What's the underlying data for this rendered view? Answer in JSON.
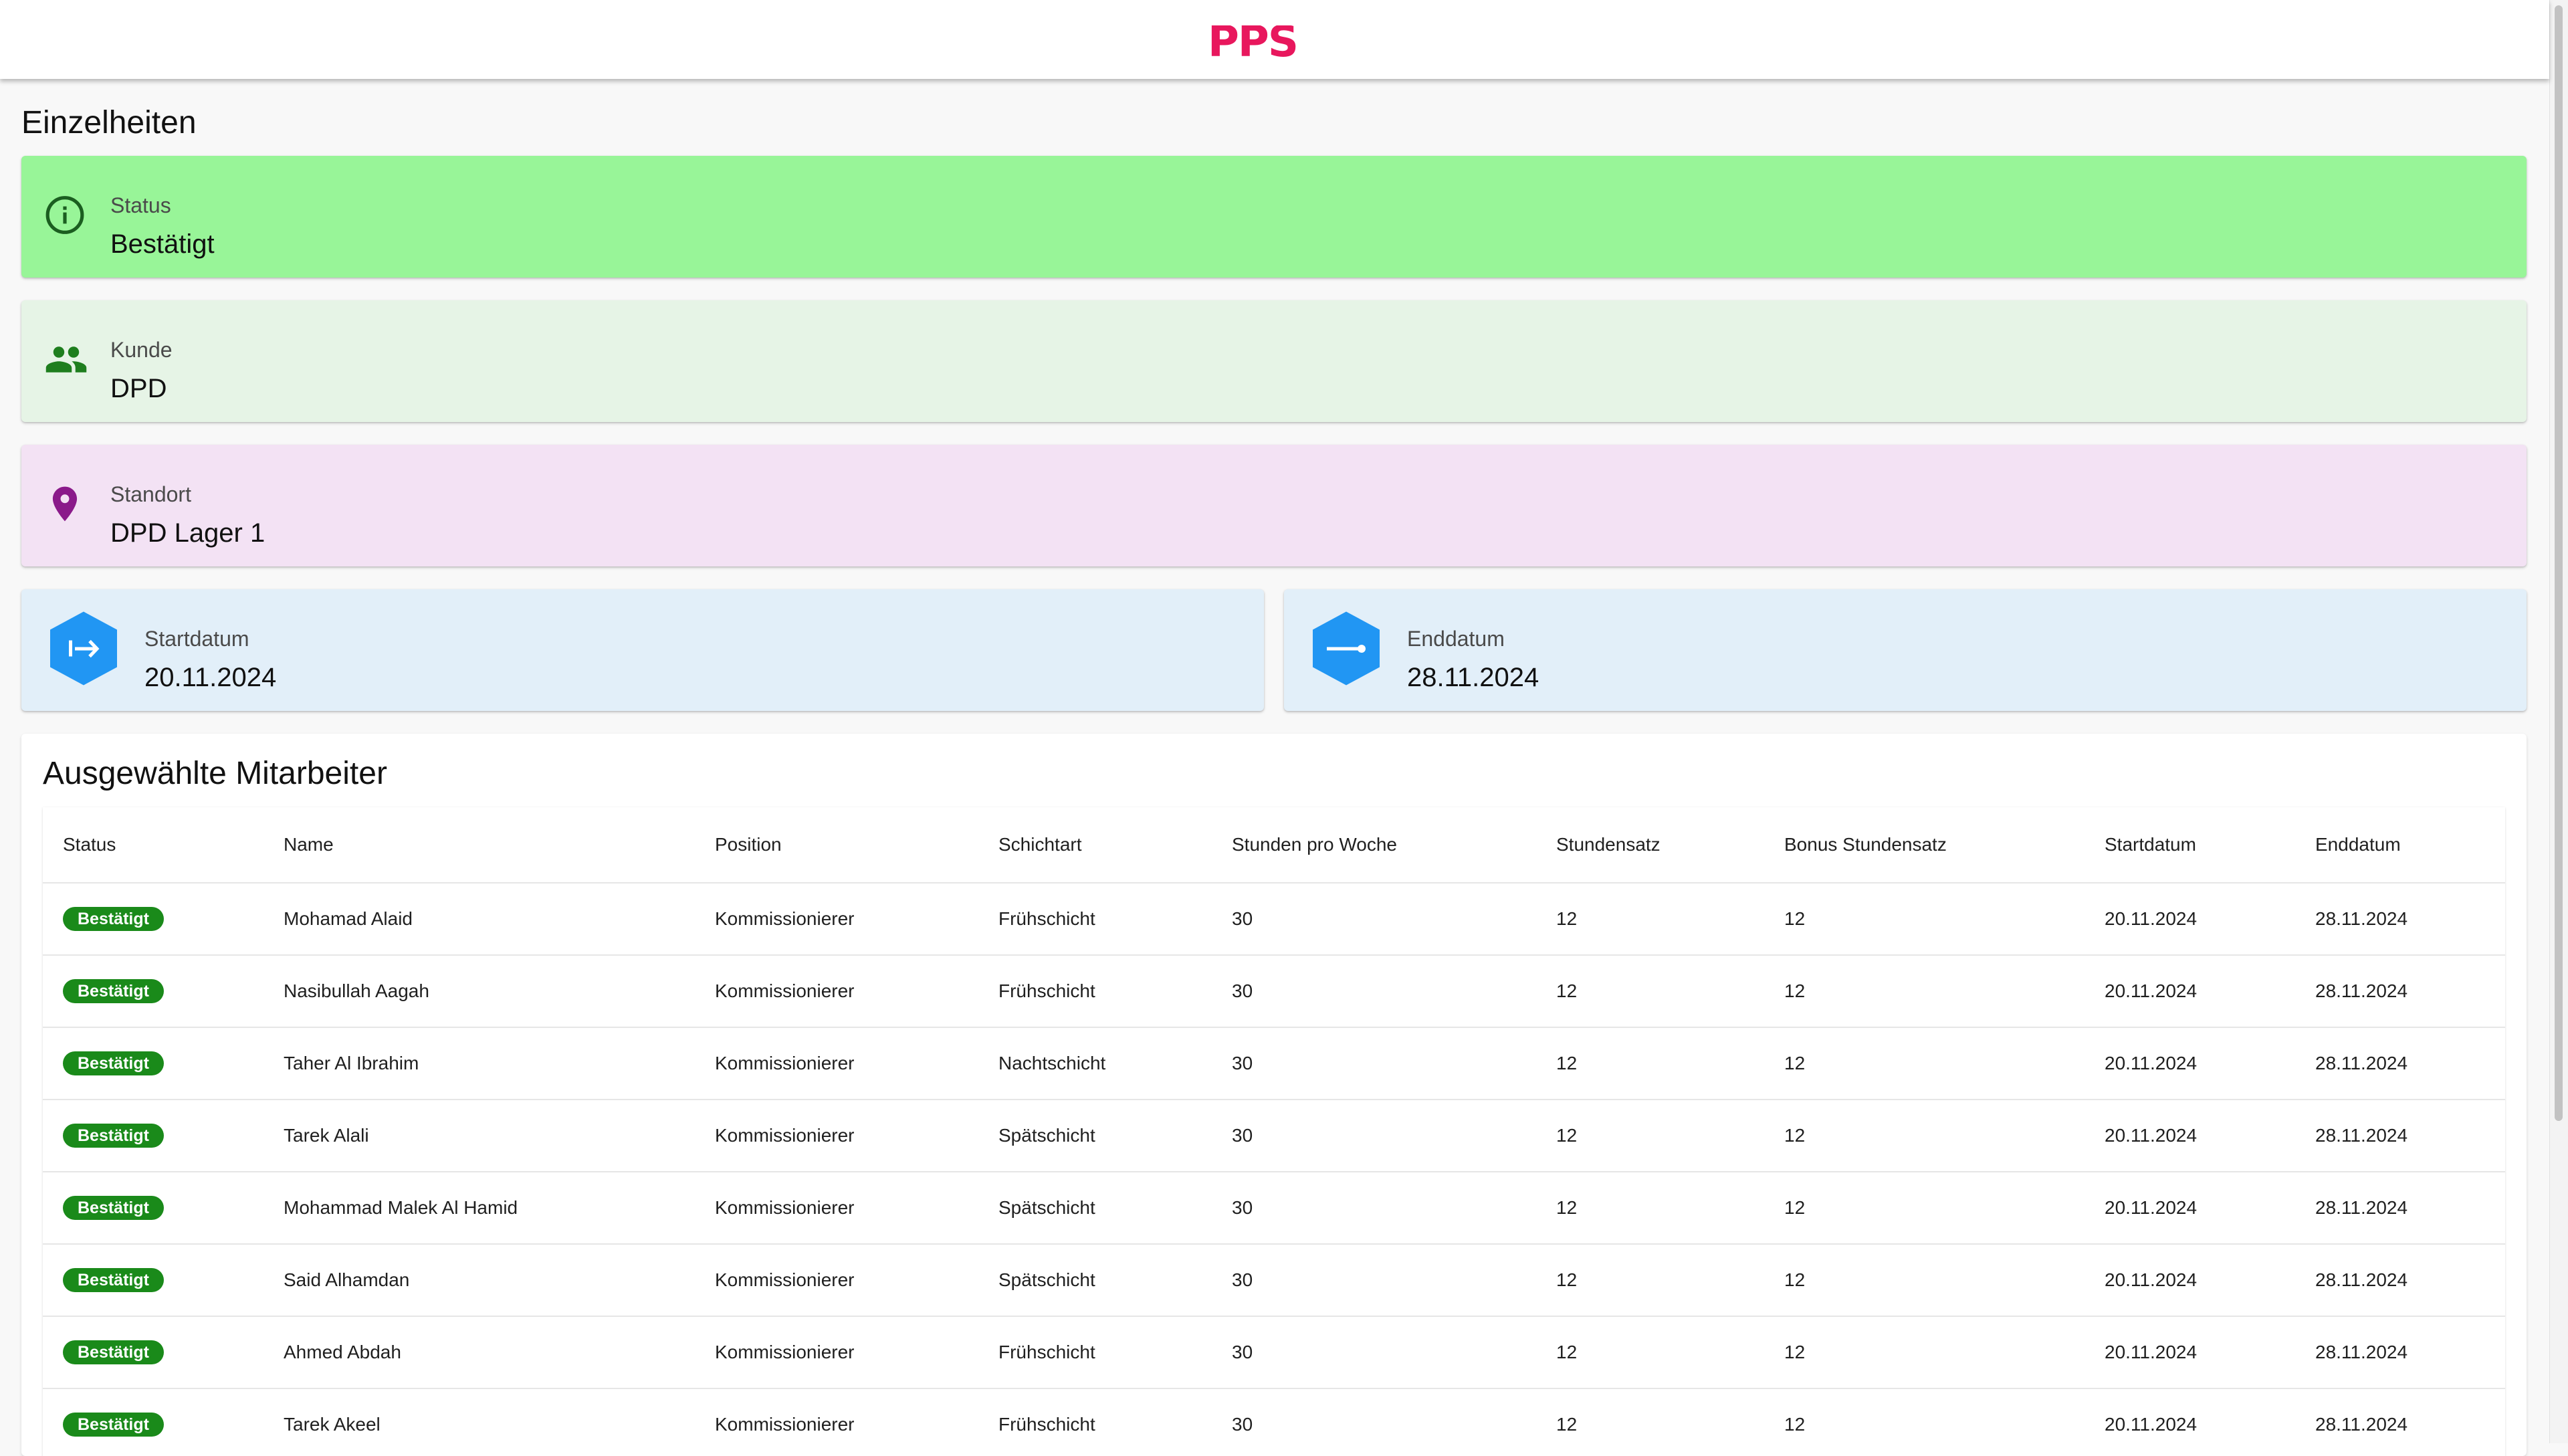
{
  "header": {
    "logo_text": "PPS",
    "logo_color": "#e8175d"
  },
  "page": {
    "title": "Einzelheiten"
  },
  "cards": {
    "status": {
      "label": "Status",
      "value": "Bestätigt",
      "icon": "info-icon",
      "color": "#98f598"
    },
    "kunde": {
      "label": "Kunde",
      "value": "DPD",
      "icon": "people-icon",
      "color": "#e6f4e6"
    },
    "standort": {
      "label": "Standort",
      "value": "DPD Lager 1",
      "icon": "location-pin-icon",
      "color": "#f3e2f4"
    },
    "startdatum": {
      "label": "Startdatum",
      "value": "20.11.2024",
      "icon": "start-arrow-icon",
      "color": "#e2eff9"
    },
    "enddatum": {
      "label": "Enddatum",
      "value": "28.11.2024",
      "icon": "end-line-icon",
      "color": "#e2eff9"
    }
  },
  "employees": {
    "title": "Ausgewählte Mitarbeiter",
    "columns": [
      "Status",
      "Name",
      "Position",
      "Schichtart",
      "Stunden pro Woche",
      "Stundensatz",
      "Bonus Stundensatz",
      "Startdatum",
      "Enddatum"
    ],
    "badge_color": "#1a8a1a",
    "rows": [
      {
        "status": "Bestätigt",
        "name": "Mohamad Alaid",
        "position": "Kommissionierer",
        "schichtart": "Frühschicht",
        "stunden": "30",
        "satz": "12",
        "bonus": "12",
        "start": "20.11.2024",
        "end": "28.11.2024"
      },
      {
        "status": "Bestätigt",
        "name": "Nasibullah Aagah",
        "position": "Kommissionierer",
        "schichtart": "Frühschicht",
        "stunden": "30",
        "satz": "12",
        "bonus": "12",
        "start": "20.11.2024",
        "end": "28.11.2024"
      },
      {
        "status": "Bestätigt",
        "name": "Taher Al Ibrahim",
        "position": "Kommissionierer",
        "schichtart": "Nachtschicht",
        "stunden": "30",
        "satz": "12",
        "bonus": "12",
        "start": "20.11.2024",
        "end": "28.11.2024"
      },
      {
        "status": "Bestätigt",
        "name": "Tarek Alali",
        "position": "Kommissionierer",
        "schichtart": "Spätschicht",
        "stunden": "30",
        "satz": "12",
        "bonus": "12",
        "start": "20.11.2024",
        "end": "28.11.2024"
      },
      {
        "status": "Bestätigt",
        "name": "Mohammad Malek Al Hamid",
        "position": "Kommissionierer",
        "schichtart": "Spätschicht",
        "stunden": "30",
        "satz": "12",
        "bonus": "12",
        "start": "20.11.2024",
        "end": "28.11.2024"
      },
      {
        "status": "Bestätigt",
        "name": "Said Alhamdan",
        "position": "Kommissionierer",
        "schichtart": "Spätschicht",
        "stunden": "30",
        "satz": "12",
        "bonus": "12",
        "start": "20.11.2024",
        "end": "28.11.2024"
      },
      {
        "status": "Bestätigt",
        "name": "Ahmed Abdah",
        "position": "Kommissionierer",
        "schichtart": "Frühschicht",
        "stunden": "30",
        "satz": "12",
        "bonus": "12",
        "start": "20.11.2024",
        "end": "28.11.2024"
      },
      {
        "status": "Bestätigt",
        "name": "Tarek Akeel",
        "position": "Kommissionierer",
        "schichtart": "Frühschicht",
        "stunden": "30",
        "satz": "12",
        "bonus": "12",
        "start": "20.11.2024",
        "end": "28.11.2024"
      }
    ]
  }
}
